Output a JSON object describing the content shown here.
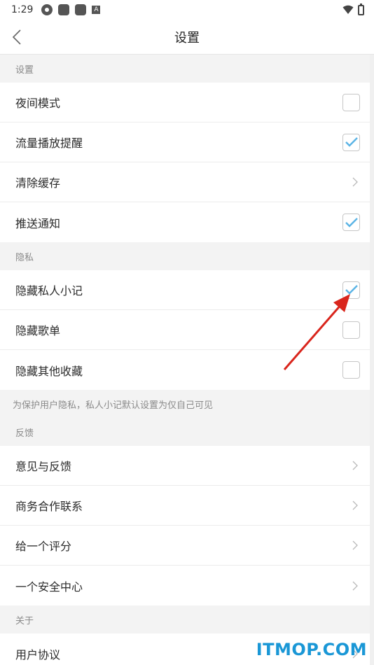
{
  "status_bar": {
    "time": "1:29",
    "app_badge": "A"
  },
  "header": {
    "title": "设置"
  },
  "sections": {
    "settings": {
      "title": "设置",
      "items": [
        {
          "label": "夜间模式",
          "control": "checkbox",
          "checked": false
        },
        {
          "label": "流量播放提醒",
          "control": "checkbox",
          "checked": true
        },
        {
          "label": "清除缓存",
          "control": "chevron"
        },
        {
          "label": "推送通知",
          "control": "checkbox",
          "checked": true
        }
      ]
    },
    "privacy": {
      "title": "隐私",
      "items": [
        {
          "label": "隐藏私人小记",
          "control": "checkbox",
          "checked": true
        },
        {
          "label": "隐藏歌单",
          "control": "checkbox",
          "checked": false
        },
        {
          "label": "隐藏其他收藏",
          "control": "checkbox",
          "checked": false
        }
      ],
      "note": "为保护用户隐私，私人小记默认设置为仅自己可见"
    },
    "feedback": {
      "title": "反馈",
      "items": [
        {
          "label": "意见与反馈",
          "control": "chevron"
        },
        {
          "label": "商务合作联系",
          "control": "chevron"
        },
        {
          "label": "给一个评分",
          "control": "chevron"
        },
        {
          "label": "一个安全中心",
          "control": "chevron"
        }
      ]
    },
    "about": {
      "title": "关于",
      "items": [
        {
          "label": "用户协议",
          "control": "chevron"
        }
      ]
    }
  },
  "watermark": "ITMOP.COM",
  "colors": {
    "check": "#5bb4e5",
    "arrow": "#d9251c",
    "watermark": "#1a97d6"
  },
  "icons": [
    "back-icon",
    "checkmark-icon",
    "chevron-right-icon",
    "wifi-icon",
    "battery-icon"
  ]
}
